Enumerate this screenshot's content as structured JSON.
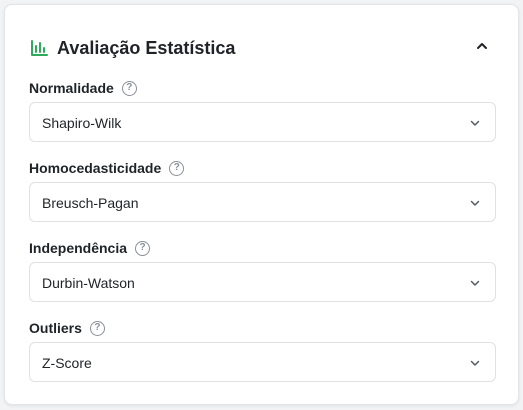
{
  "panel": {
    "title": "Avaliação Estatística",
    "header_icon": "bar-chart-icon",
    "collapse_icon": "chevron-up-icon",
    "accent_color": "#2eaa5c"
  },
  "fields": [
    {
      "label": "Normalidade",
      "value": "Shapiro-Wilk"
    },
    {
      "label": "Homocedasticidade",
      "value": "Breusch-Pagan"
    },
    {
      "label": "Independência",
      "value": "Durbin-Watson"
    },
    {
      "label": "Outliers",
      "value": "Z-Score"
    }
  ],
  "help_glyph": "?"
}
